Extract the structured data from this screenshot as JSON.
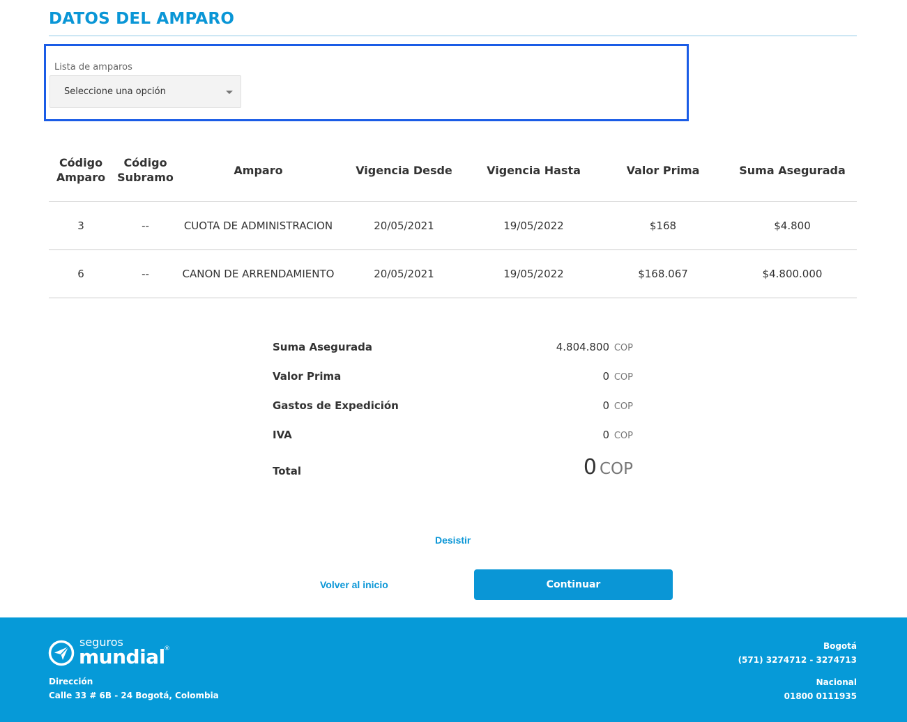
{
  "header": {
    "title": "DATOS DEL AMPARO"
  },
  "selector": {
    "label": "Lista de amparos",
    "value": "Seleccione una opción"
  },
  "table": {
    "columns": [
      "Código Amparo",
      "Código Subramo",
      "Amparo",
      "Vigencia Desde",
      "Vigencia Hasta",
      "Valor Prima",
      "Suma Asegurada"
    ],
    "rows": [
      [
        "3",
        "--",
        "CUOTA DE ADMINISTRACION",
        "20/05/2021",
        "19/05/2022",
        "$168",
        "$4.800"
      ],
      [
        "6",
        "--",
        "CANON DE ARRENDAMIENTO",
        "20/05/2021",
        "19/05/2022",
        "$168.067",
        "$4.800.000"
      ]
    ]
  },
  "summary": {
    "currency": "COP",
    "rows": [
      {
        "label": "Suma Asegurada",
        "value": "4.804.800"
      },
      {
        "label": "Valor Prima",
        "value": "0"
      },
      {
        "label": "Gastos de Expedición",
        "value": "0"
      },
      {
        "label": "IVA",
        "value": "0"
      }
    ],
    "total": {
      "label": "Total",
      "value": "0"
    }
  },
  "actions": {
    "desistir": "Desistir",
    "volver": "Volver al inicio",
    "continuar": "Continuar"
  },
  "footer": {
    "logo_small": "seguros",
    "logo_big": "mundial",
    "logo_reg": "®",
    "address_label": "Dirección",
    "address": "Calle 33 # 6B - 24 Bogotá, Colombia",
    "city_label": "Bogotá",
    "city_phone": "(571) 3274712 - 3274713",
    "national_label": "Nacional",
    "national_phone": "01800 0111935"
  },
  "colors": {
    "brand": "#0a96d6",
    "footer": "#069ad8",
    "highlight": "#1a5ce6"
  },
  "icons": {
    "select": "chevron-down-icon",
    "logo": "paper-plane-icon"
  }
}
